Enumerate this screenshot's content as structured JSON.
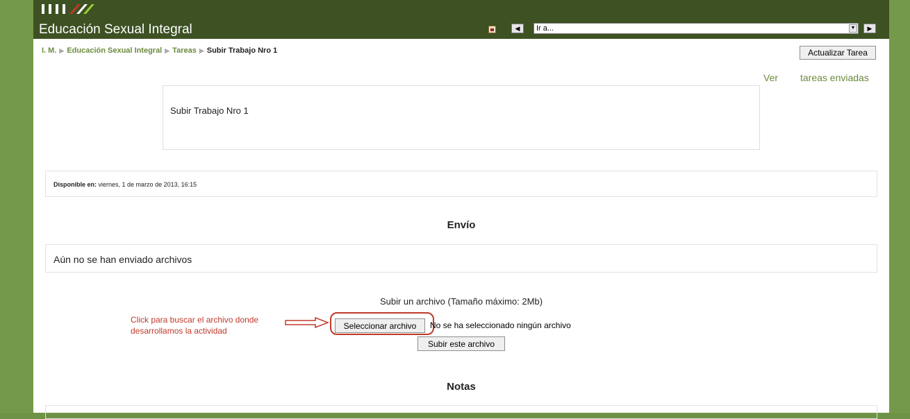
{
  "header": {
    "site_title": "Educación Sexual Integral",
    "jump_placeholder": "Ir a..."
  },
  "breadcrumb": {
    "items": [
      "I. M.",
      "Educación Sexual Integral",
      "Tareas"
    ],
    "current": "Subir Trabajo Nro 1"
  },
  "actions": {
    "update_button": "Actualizar Tarea",
    "ver_link": "Ver",
    "tareas_link": "tareas enviadas"
  },
  "assignment": {
    "intro": "Subir Trabajo Nro 1",
    "available_label": "Disponible en:",
    "available_date": "viernes, 1 de marzo de 2013, 16:15"
  },
  "submission": {
    "heading": "Envío",
    "no_files": "Aún no se han enviado archivos",
    "upload_label": "Subir un archivo (Tamaño máximo: 2Mb)",
    "select_button": "Seleccionar archivo",
    "no_file_selected": "No se ha seleccionado ningún archivo",
    "submit_button": "Subir este archivo"
  },
  "annotation": {
    "line1": "Click para buscar el archivo donde",
    "line2": "desarrollamos la actividad"
  },
  "grades": {
    "heading": "Notas"
  },
  "colors": {
    "header_bg": "#3d5123",
    "side_bg": "#74994a",
    "link": "#6b8a3e",
    "annotation": "#c0392b"
  }
}
